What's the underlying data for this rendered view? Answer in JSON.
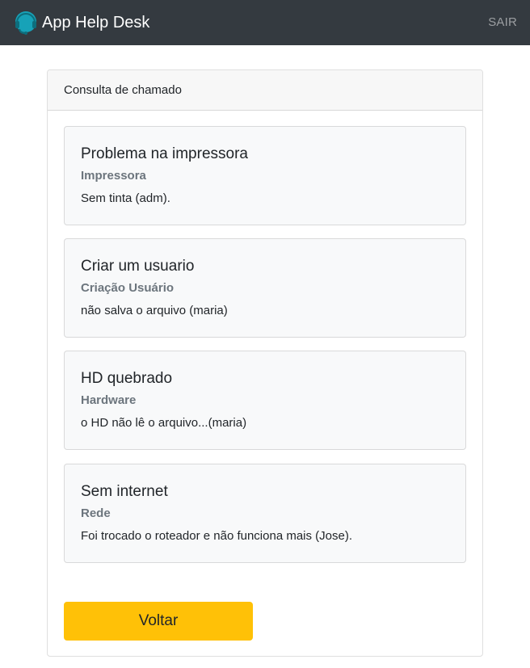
{
  "navbar": {
    "brand_title": "App Help Desk",
    "logout_label": "SAIR",
    "logo_icon": "headset-icon",
    "logo_color": "#17a2b8"
  },
  "panel": {
    "header": "Consulta de chamado",
    "tickets": [
      {
        "title": "Problema na impressora",
        "category": "Impressora",
        "description": "Sem tinta (adm)."
      },
      {
        "title": "Criar um usuario",
        "category": "Criação Usuário",
        "description": "não salva o arquivo (maria)"
      },
      {
        "title": "HD quebrado",
        "category": "Hardware",
        "description": "o HD não lê o arquivo...(maria)"
      },
      {
        "title": "Sem internet",
        "category": "Rede",
        "description": "Foi trocado o roteador e não funciona mais (Jose)."
      }
    ],
    "back_label": "Voltar"
  },
  "colors": {
    "navbar_bg": "#343a40",
    "button_bg": "#ffc107",
    "card_bg": "#f8f9fa",
    "category_text": "#6c757d"
  }
}
